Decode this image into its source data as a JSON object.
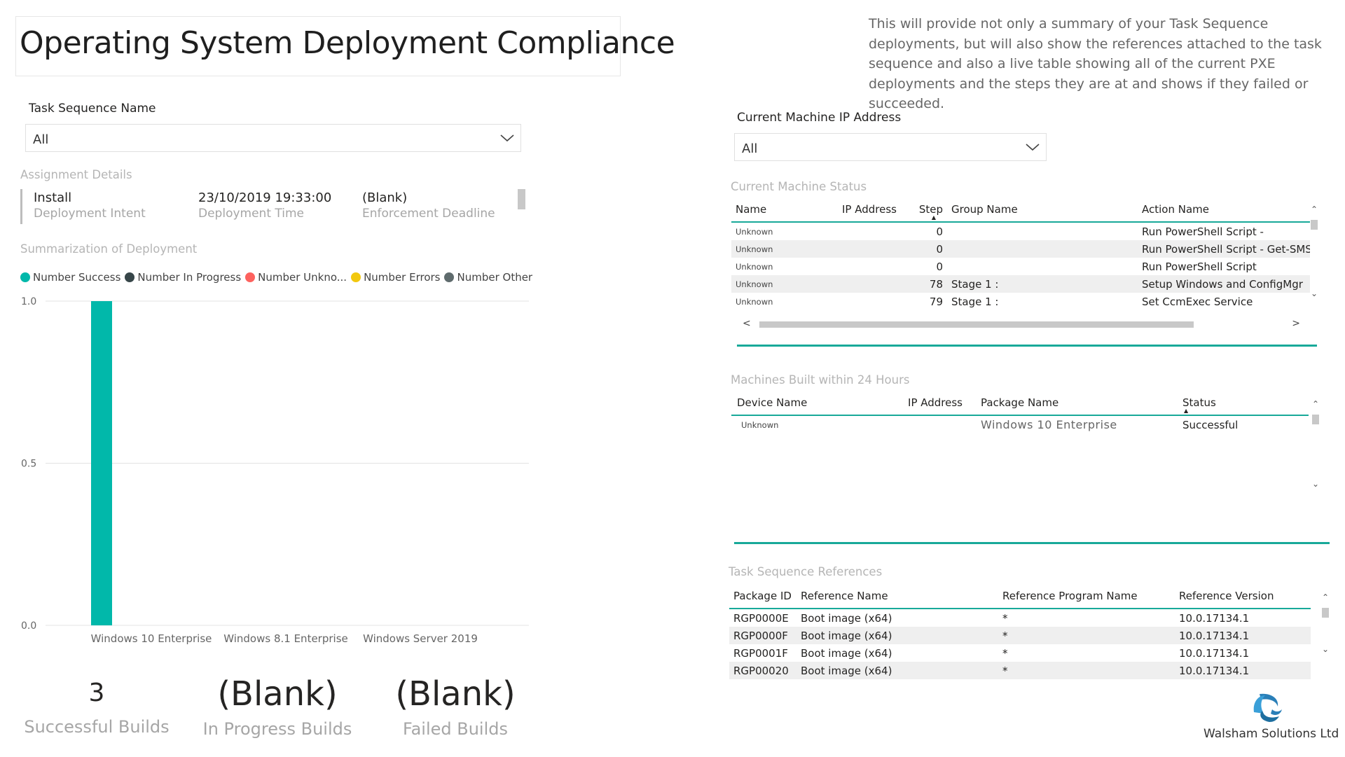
{
  "page": {
    "title": "Operating System Deployment Compliance",
    "description": "This will provide not only a summary of your Task Sequence deployments, but will also show the references attached to the task sequence and also a live table showing all of the current PXE deployments and the steps they are at and shows if they failed or succeeded."
  },
  "task_sequence_slicer": {
    "label": "Task Sequence Name",
    "value": "All"
  },
  "assignment_details": {
    "title": "Assignment Details",
    "cards": [
      {
        "value": "Install",
        "label": "Deployment Intent"
      },
      {
        "value": "23/10/2019 19:33:00",
        "label": "Deployment Time"
      },
      {
        "value": "(Blank)",
        "label": "Enforcement Deadline"
      }
    ]
  },
  "summarization": {
    "title": "Summarization of Deployment",
    "legend": [
      {
        "name": "Number Success",
        "color": "#01B8AA"
      },
      {
        "name": "Number In Progress",
        "color": "#374649"
      },
      {
        "name": "Number Unkno...",
        "color": "#FD625E"
      },
      {
        "name": "Number Errors",
        "color": "#F2C80F"
      },
      {
        "name": "Number Other",
        "color": "#5F6B6D"
      }
    ]
  },
  "chart_data": {
    "type": "bar",
    "categories": [
      "Windows 10 Enterprise",
      "Windows 8.1 Enterprise",
      "Windows Server 2019"
    ],
    "series": [
      {
        "name": "Number Success",
        "color": "#01B8AA",
        "values": [
          1,
          0,
          0
        ]
      },
      {
        "name": "Number In Progress",
        "color": "#374649",
        "values": [
          0,
          0,
          0
        ]
      },
      {
        "name": "Number Unkno...",
        "color": "#FD625E",
        "values": [
          0,
          0,
          0
        ]
      },
      {
        "name": "Number Errors",
        "color": "#F2C80F",
        "values": [
          0,
          0,
          0
        ]
      },
      {
        "name": "Number Other",
        "color": "#5F6B6D",
        "values": [
          0,
          0,
          0
        ]
      }
    ],
    "yticks": [
      "1.0",
      "0.5",
      "0.0"
    ],
    "ylim": [
      0,
      1
    ],
    "grid": true,
    "legend_position": "top-left"
  },
  "kpis": [
    {
      "value": "3",
      "label": "Successful Builds"
    },
    {
      "value": "(Blank)",
      "label": "In Progress Builds"
    },
    {
      "value": "(Blank)",
      "label": "Failed Builds"
    }
  ],
  "ip_slicer": {
    "label": "Current Machine IP Address",
    "value": "All"
  },
  "machine_status": {
    "title": "Current Machine Status",
    "columns": [
      "Name",
      "IP Address",
      "Step",
      "Group Name",
      "Action Name"
    ],
    "rows": [
      {
        "name": "Unknown",
        "ip": "",
        "step": "0",
        "group": "",
        "action": "Run PowerShell Script -"
      },
      {
        "name": "Unknown",
        "ip": "",
        "step": "0",
        "group": "",
        "action": "Run PowerShell Script - Get-SMSTS\\"
      },
      {
        "name": "Unknown",
        "ip": "",
        "step": "0",
        "group": "",
        "action": "Run PowerShell Script"
      },
      {
        "name": "Unknown",
        "ip": "",
        "step": "78",
        "group": "Stage 1 :",
        "action": "Setup Windows and ConfigMgr"
      },
      {
        "name": "Unknown",
        "ip": "",
        "step": "79",
        "group": "Stage 1 :",
        "action": "Set CcmExec Service"
      }
    ]
  },
  "machines_built": {
    "title": "Machines Built within 24 Hours",
    "columns": [
      "Device Name",
      "IP Address",
      "Package Name",
      "Status"
    ],
    "rows": [
      {
        "device": "Unknown",
        "ip": "",
        "package": "Windows 10 Enterprise",
        "status": "Successful"
      }
    ]
  },
  "ts_references": {
    "title": "Task Sequence References",
    "columns": [
      "Package ID",
      "Reference Name",
      "Reference Program Name",
      "Reference Version"
    ],
    "rows": [
      {
        "id": "RGP0000E",
        "name": "Boot image (x64)",
        "program": "*",
        "version": "10.0.17134.1"
      },
      {
        "id": "RGP0000F",
        "name": "Boot image (x64)",
        "program": "*",
        "version": "10.0.17134.1"
      },
      {
        "id": "RGP0001F",
        "name": "Boot image (x64)",
        "program": "*",
        "version": "10.0.17134.1"
      },
      {
        "id": "RGP00020",
        "name": "Boot image (x64)",
        "program": "*",
        "version": "10.0.17134.1"
      }
    ]
  },
  "logo": {
    "text": "Walsham Solutions Ltd",
    "icon": "walsham-logo-icon",
    "color": "#2a7fb8"
  }
}
